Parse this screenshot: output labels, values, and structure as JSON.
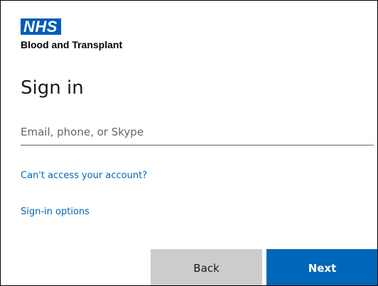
{
  "brand": {
    "logo_text": "NHS",
    "org_name": "Blood and Transplant",
    "logo_color": "#005eb8"
  },
  "signin": {
    "title": "Sign in",
    "email_placeholder": "Email, phone, or Skype",
    "email_value": "",
    "links": {
      "cant_access": "Can't access your account?",
      "signin_options": "Sign-in options"
    },
    "buttons": {
      "back": "Back",
      "next": "Next"
    }
  },
  "colors": {
    "accent": "#0067b8",
    "secondary_button": "#cccccc",
    "text": "#1b1b1b"
  }
}
